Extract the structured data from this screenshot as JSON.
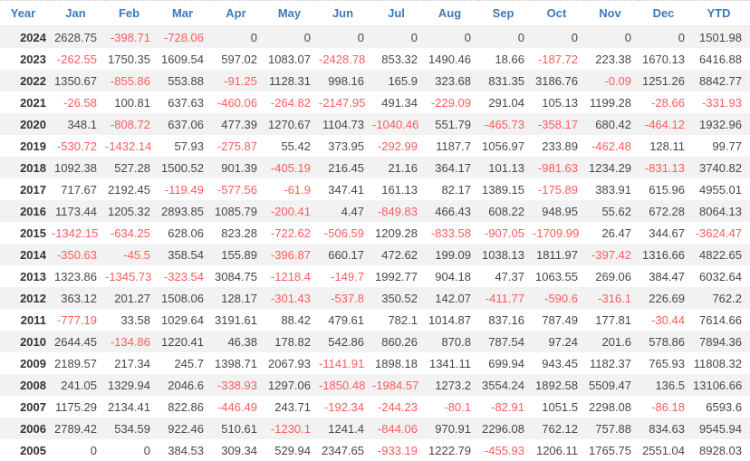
{
  "colors": {
    "header_text": "#3e79ba",
    "positive_value": "#474747",
    "negative_value": "#fb5c5c",
    "year_text": "#333333",
    "stripe_row": "#f2f2f2",
    "background": "#ffffff"
  },
  "chart_data": {
    "type": "table",
    "columns": [
      "Year",
      "Jan",
      "Feb",
      "Mar",
      "Apr",
      "May",
      "Jun",
      "Jul",
      "Aug",
      "Sep",
      "Oct",
      "Nov",
      "Dec",
      "YTD"
    ],
    "rows": [
      [
        "2024",
        2628.75,
        -398.71,
        -728.06,
        0,
        0,
        0,
        0,
        0,
        0,
        0,
        0,
        0,
        1501.98
      ],
      [
        "2023",
        -262.55,
        1750.35,
        1609.54,
        597.02,
        1083.07,
        -2428.78,
        853.32,
        1490.46,
        18.66,
        -187.72,
        223.38,
        1670.13,
        6416.88
      ],
      [
        "2022",
        1350.67,
        -855.86,
        553.88,
        -91.25,
        1128.31,
        998.16,
        165.9,
        323.68,
        831.35,
        3186.76,
        -0.09,
        1251.26,
        8842.77
      ],
      [
        "2021",
        -26.58,
        100.81,
        637.63,
        -460.06,
        -264.82,
        -2147.95,
        491.34,
        -229.09,
        291.04,
        105.13,
        1199.28,
        -28.66,
        -331.93
      ],
      [
        "2020",
        348.1,
        -808.72,
        637.06,
        477.39,
        1270.67,
        1104.73,
        -1040.46,
        551.79,
        -465.73,
        -358.17,
        680.42,
        -464.12,
        1932.96
      ],
      [
        "2019",
        -530.72,
        -1432.14,
        57.93,
        -275.87,
        55.42,
        373.95,
        -292.99,
        1187.7,
        1056.97,
        233.89,
        -462.48,
        128.11,
        99.77
      ],
      [
        "2018",
        1092.38,
        527.28,
        1500.52,
        901.39,
        -405.19,
        216.45,
        21.16,
        364.17,
        101.13,
        -981.63,
        1234.29,
        -831.13,
        3740.82
      ],
      [
        "2017",
        717.67,
        2192.45,
        -119.49,
        -577.56,
        -61.9,
        347.41,
        161.13,
        82.17,
        1389.15,
        -175.89,
        383.91,
        615.96,
        4955.01
      ],
      [
        "2016",
        1173.44,
        1205.32,
        2893.85,
        1085.79,
        -200.41,
        4.47,
        -849.83,
        466.43,
        608.22,
        948.95,
        55.62,
        672.28,
        8064.13
      ],
      [
        "2015",
        -1342.15,
        -634.25,
        628.06,
        823.28,
        -722.62,
        -506.59,
        1209.28,
        -833.58,
        -907.05,
        -1709.99,
        26.47,
        344.67,
        -3624.47
      ],
      [
        "2014",
        -350.63,
        -45.5,
        358.54,
        155.89,
        -396.87,
        660.17,
        472.62,
        199.09,
        1038.13,
        1811.97,
        -397.42,
        1316.66,
        4822.65
      ],
      [
        "2013",
        1323.86,
        -1345.73,
        -323.54,
        3084.75,
        -1218.4,
        -149.7,
        1992.77,
        904.18,
        47.37,
        1063.55,
        269.06,
        384.47,
        6032.64
      ],
      [
        "2012",
        363.12,
        201.27,
        1508.06,
        128.17,
        -301.43,
        -537.8,
        350.52,
        142.07,
        -411.77,
        -590.6,
        -316.1,
        226.69,
        762.2
      ],
      [
        "2011",
        -777.19,
        33.58,
        1029.64,
        3191.61,
        88.42,
        479.61,
        782.1,
        1014.87,
        837.16,
        787.49,
        177.81,
        -30.44,
        7614.66
      ],
      [
        "2010",
        2644.45,
        -134.86,
        1220.41,
        46.38,
        178.82,
        542.86,
        860.26,
        870.8,
        787.54,
        97.24,
        201.6,
        578.86,
        7894.36
      ],
      [
        "2009",
        2189.57,
        217.34,
        245.7,
        1398.71,
        2067.93,
        -1141.91,
        1898.18,
        1341.11,
        699.94,
        943.45,
        1182.37,
        765.93,
        11808.32
      ],
      [
        "2008",
        241.05,
        1329.94,
        2046.6,
        -338.93,
        1297.06,
        -1850.48,
        -1984.57,
        1273.2,
        3554.24,
        1892.58,
        5509.47,
        136.5,
        13106.66
      ],
      [
        "2007",
        1175.29,
        2134.41,
        822.86,
        -446.49,
        243.71,
        -192.34,
        -244.23,
        -80.1,
        -82.91,
        1051.5,
        2298.08,
        -86.18,
        6593.6
      ],
      [
        "2006",
        2789.42,
        534.59,
        922.46,
        510.61,
        -1230.1,
        1241.4,
        -844.06,
        970.91,
        2296.08,
        762.12,
        757.88,
        834.63,
        9545.94
      ],
      [
        "2005",
        0,
        0,
        384.53,
        309.34,
        529.94,
        2347.65,
        -933.19,
        1222.79,
        -455.93,
        1206.11,
        1765.75,
        2551.04,
        8928.03
      ]
    ]
  }
}
